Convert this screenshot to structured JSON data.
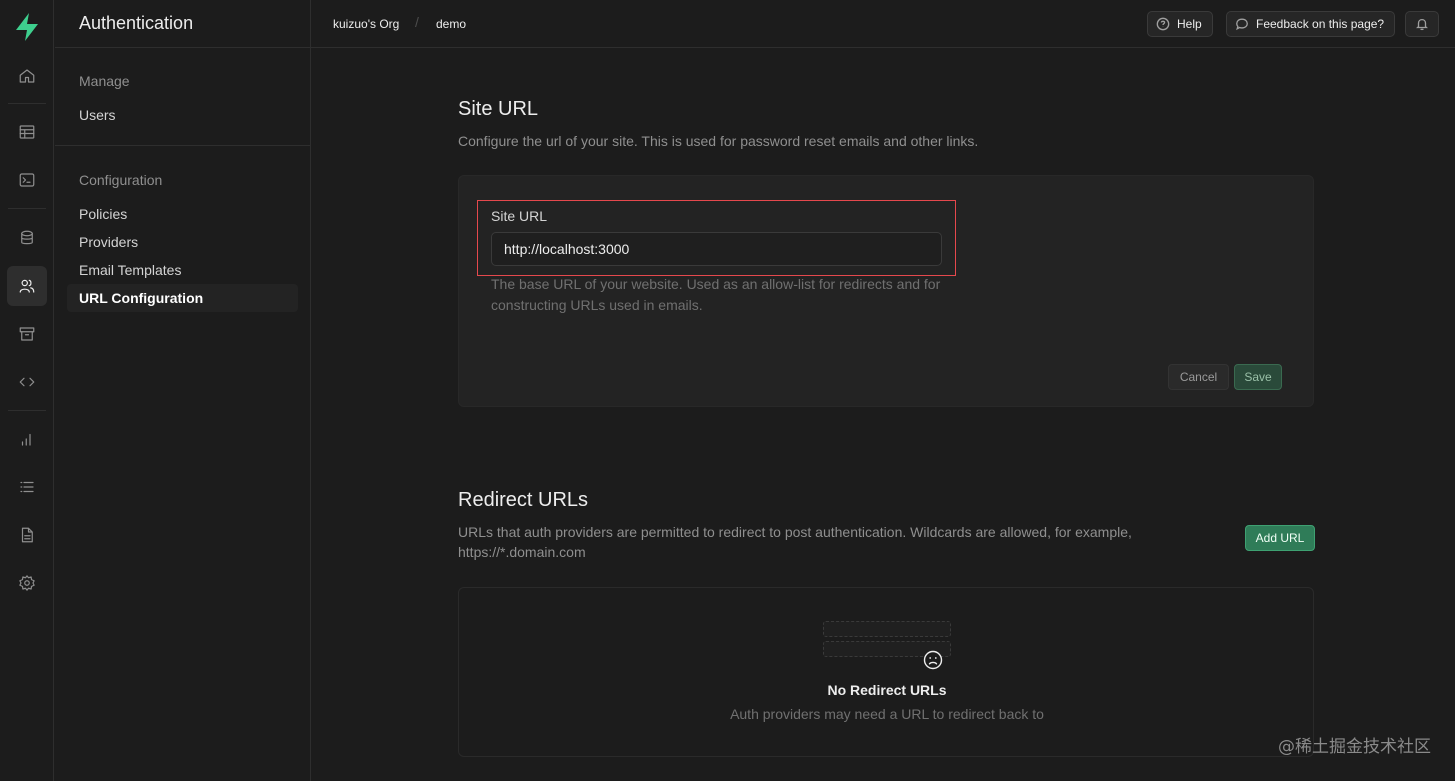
{
  "app": {
    "section_title": "Authentication",
    "brand_color": "#3ecf8e"
  },
  "breadcrumb": {
    "org": "kuizuo's Org",
    "project": "demo"
  },
  "topbar": {
    "help_label": "Help",
    "feedback_label": "Feedback on this page?"
  },
  "nav_rail": [
    "home-icon",
    "table-icon",
    "terminal-icon",
    "database-icon",
    "users-icon",
    "archive-icon",
    "code-icon",
    "chart-icon",
    "list-icon",
    "document-icon",
    "settings-icon"
  ],
  "sidebar": {
    "manage_title": "Manage",
    "manage_items": [
      {
        "label": "Users"
      }
    ],
    "config_title": "Configuration",
    "config_items": [
      {
        "label": "Policies"
      },
      {
        "label": "Providers"
      },
      {
        "label": "Email Templates"
      },
      {
        "label": "URL Configuration",
        "active": true
      }
    ]
  },
  "site_url": {
    "title": "Site URL",
    "description": "Configure the url of your site. This is used for password reset emails and other links.",
    "field_label": "Site URL",
    "field_value": "http://localhost:3000",
    "field_help": "The base URL of your website. Used as an allow-list for redirects and for constructing URLs used in emails.",
    "cancel_label": "Cancel",
    "save_label": "Save"
  },
  "redirect_urls": {
    "title": "Redirect URLs",
    "description_line1": "URLs that auth providers are permitted to redirect to post authentication. Wildcards are allowed, for example,",
    "description_line2": "https://*.domain.com",
    "add_label": "Add URL",
    "empty_title": "No Redirect URLs",
    "empty_subtitle": "Auth providers may need a URL to redirect back to"
  },
  "watermark": "@稀土掘金技术社区"
}
